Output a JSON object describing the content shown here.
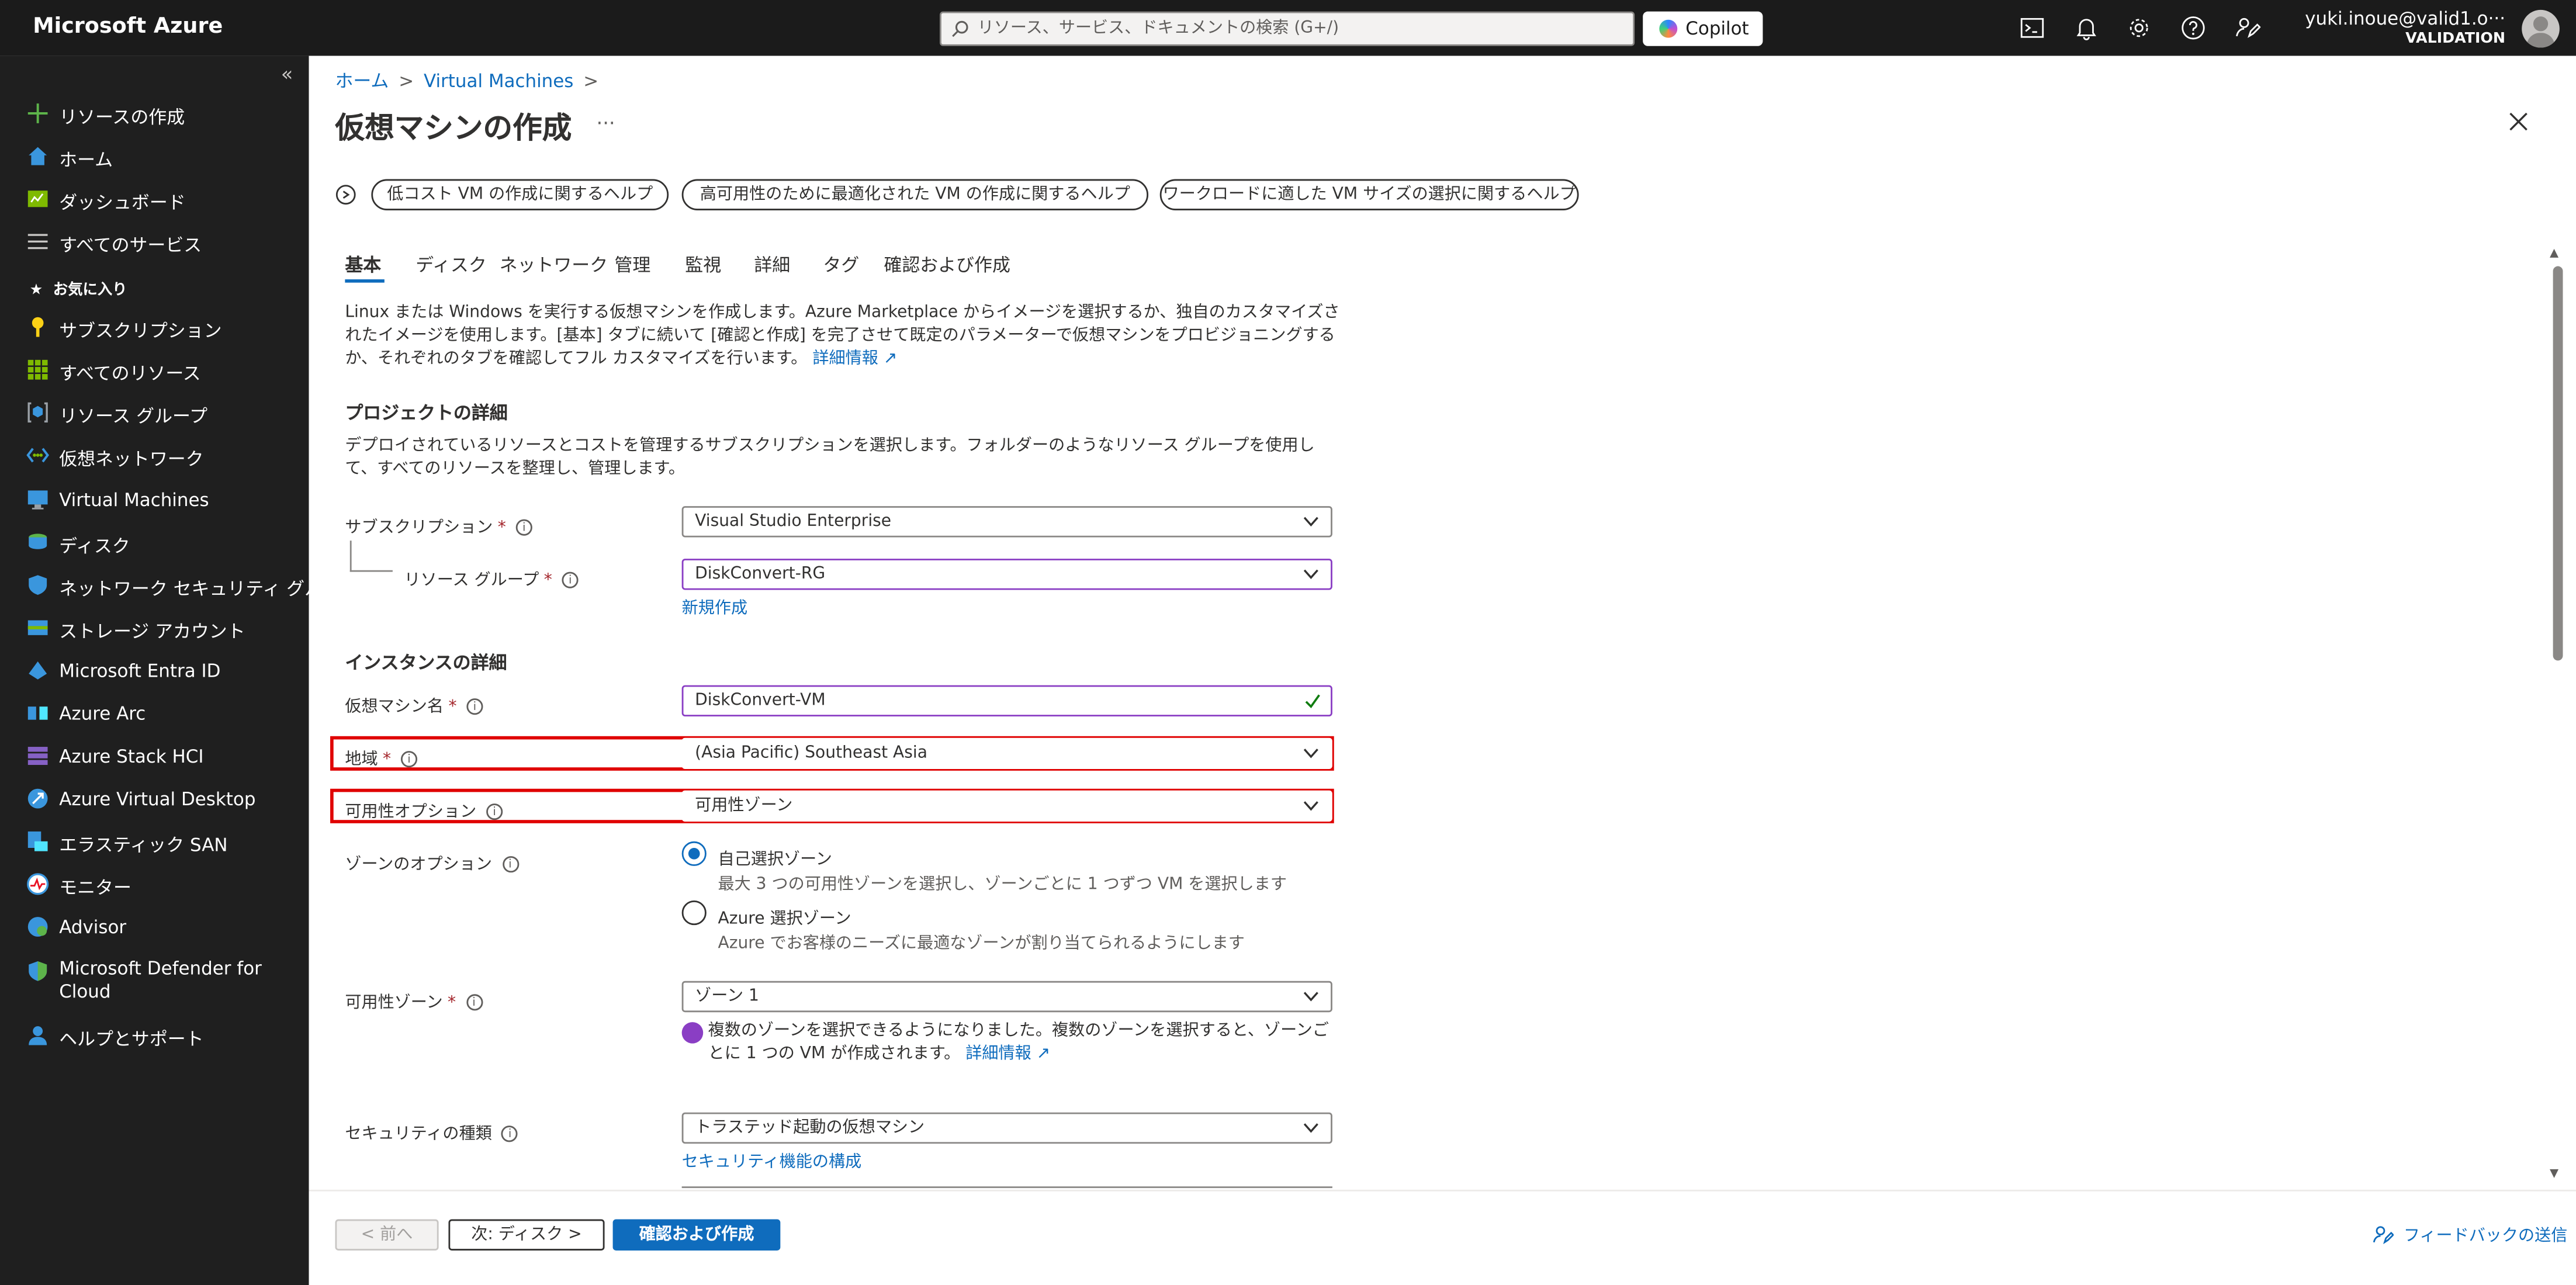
{
  "topbar": {
    "brand": "Microsoft Azure",
    "search_placeholder": "リソース、サービス、ドキュメントの検索 (G+/)",
    "copilot_label": "Copilot",
    "user_name": "yuki.inoue@valid1.o···",
    "user_org": "VALIDATION",
    "icons": [
      "cloud-shell-icon",
      "bell-icon",
      "gear-icon",
      "help-icon",
      "feedback-icon"
    ]
  },
  "sidebar": {
    "collapse_glyph": "«",
    "favorites_label": "お気に入り",
    "items": [
      {
        "label": "リソースの作成",
        "icon": "plus-icon"
      },
      {
        "label": "ホーム",
        "icon": "home-icon"
      },
      {
        "label": "ダッシュボード",
        "icon": "dashboard-icon"
      },
      {
        "label": "すべてのサービス",
        "icon": "list-icon"
      },
      {
        "label": "サブスクリプション",
        "icon": "key-icon"
      },
      {
        "label": "すべてのリソース",
        "icon": "grid-icon"
      },
      {
        "label": "リソース グループ",
        "icon": "resource-group-icon"
      },
      {
        "label": "仮想ネットワーク",
        "icon": "vnet-icon"
      },
      {
        "label": "Virtual Machines",
        "icon": "vm-icon"
      },
      {
        "label": "ディスク",
        "icon": "disk-icon"
      },
      {
        "label": "ネットワーク セキュリティ グループ",
        "icon": "shield-icon"
      },
      {
        "label": "ストレージ アカウント",
        "icon": "storage-icon"
      },
      {
        "label": "Microsoft Entra ID",
        "icon": "entra-icon"
      },
      {
        "label": "Azure Arc",
        "icon": "arc-icon"
      },
      {
        "label": "Azure Stack HCI",
        "icon": "stack-hci-icon"
      },
      {
        "label": "Azure Virtual Desktop",
        "icon": "virtual-desktop-icon"
      },
      {
        "label": "エラスティック SAN",
        "icon": "elastic-san-icon"
      },
      {
        "label": "モニター",
        "icon": "monitor-icon"
      },
      {
        "label": "Advisor",
        "icon": "advisor-icon"
      },
      {
        "label": "Microsoft Defender for Cloud",
        "icon": "defender-icon"
      },
      {
        "label": "ヘルプとサポート",
        "icon": "support-icon"
      }
    ]
  },
  "breadcrumb": {
    "home": "ホーム",
    "vms": "Virtual Machines",
    "sep": ">"
  },
  "page": {
    "title": "仮想マシンの作成",
    "more": "···",
    "help_buttons": [
      "低コスト VM の作成に関するヘルプ",
      "高可用性のために最適化された VM の作成に関するヘルプ",
      "ワークロードに適した VM サイズの選択に関するヘルプ"
    ],
    "tabs": [
      "基本",
      "ディスク",
      "ネットワーク",
      "管理",
      "監視",
      "詳細",
      "タグ",
      "確認および作成"
    ],
    "intro_text": "Linux または Windows を実行する仮想マシンを作成します。Azure Marketplace からイメージを選択するか、独自のカスタマイズされたイメージを使用します。[基本] タブに続いて [確認と作成] を完了させて既定のパラメーターで仮想マシンをプロビジョニングするか、それぞれのタブを確認してフル カスタマイズを行います。",
    "intro_link": "詳細情報"
  },
  "project": {
    "title": "プロジェクトの詳細",
    "desc": "デプロイされているリソースとコストを管理するサブスクリプションを選択します。フォルダーのようなリソース グループを使用して、すべてのリソースを整理し、管理します。",
    "subscription_label": "サブスクリプション",
    "subscription_value": "Visual Studio Enterprise",
    "rg_label": "リソース グループ",
    "rg_value": "DiskConvert-RG",
    "rg_new_link": "新規作成"
  },
  "instance": {
    "title": "インスタンスの詳細",
    "vmname_label": "仮想マシン名",
    "vmname_value": "DiskConvert-VM",
    "region_label": "地域",
    "region_value": "(Asia Pacific) Southeast Asia",
    "avail_opt_label": "可用性オプション",
    "avail_opt_value": "可用性ゾーン",
    "zone_opt_label": "ゾーンのオプション",
    "zone_opt1_title": "自己選択ゾーン",
    "zone_opt1_desc": "最大 3 つの可用性ゾーンを選択し、ゾーンごとに 1 つずつ VM を選択します",
    "zone_opt2_title": "Azure 選択ゾーン",
    "zone_opt2_desc": "Azure でお客様のニーズに最適なゾーンが割り当てられるようにします",
    "zone_label": "可用性ゾーン",
    "zone_value": "ゾーン 1",
    "zone_notice": "複数のゾーンを選択できるようになりました。複数のゾーンを選択すると、ゾーンごとに 1 つの VM が作成されます。",
    "zone_notice_link": "詳細情報",
    "security_label": "セキュリティの種類",
    "security_value": "トラステッド起動の仮想マシン",
    "security_link": "セキュリティ機能の構成"
  },
  "footer": {
    "prev": "< 前へ",
    "next": "次: ディスク >",
    "create": "確認および作成",
    "feedback": "フィードバックの送信"
  },
  "colors": {
    "accent": "#0f6cbd",
    "highlight": "#e00000",
    "required": "#a4262c",
    "topbar": "#1b1b1b",
    "sidebar": "#1f1f1f"
  }
}
